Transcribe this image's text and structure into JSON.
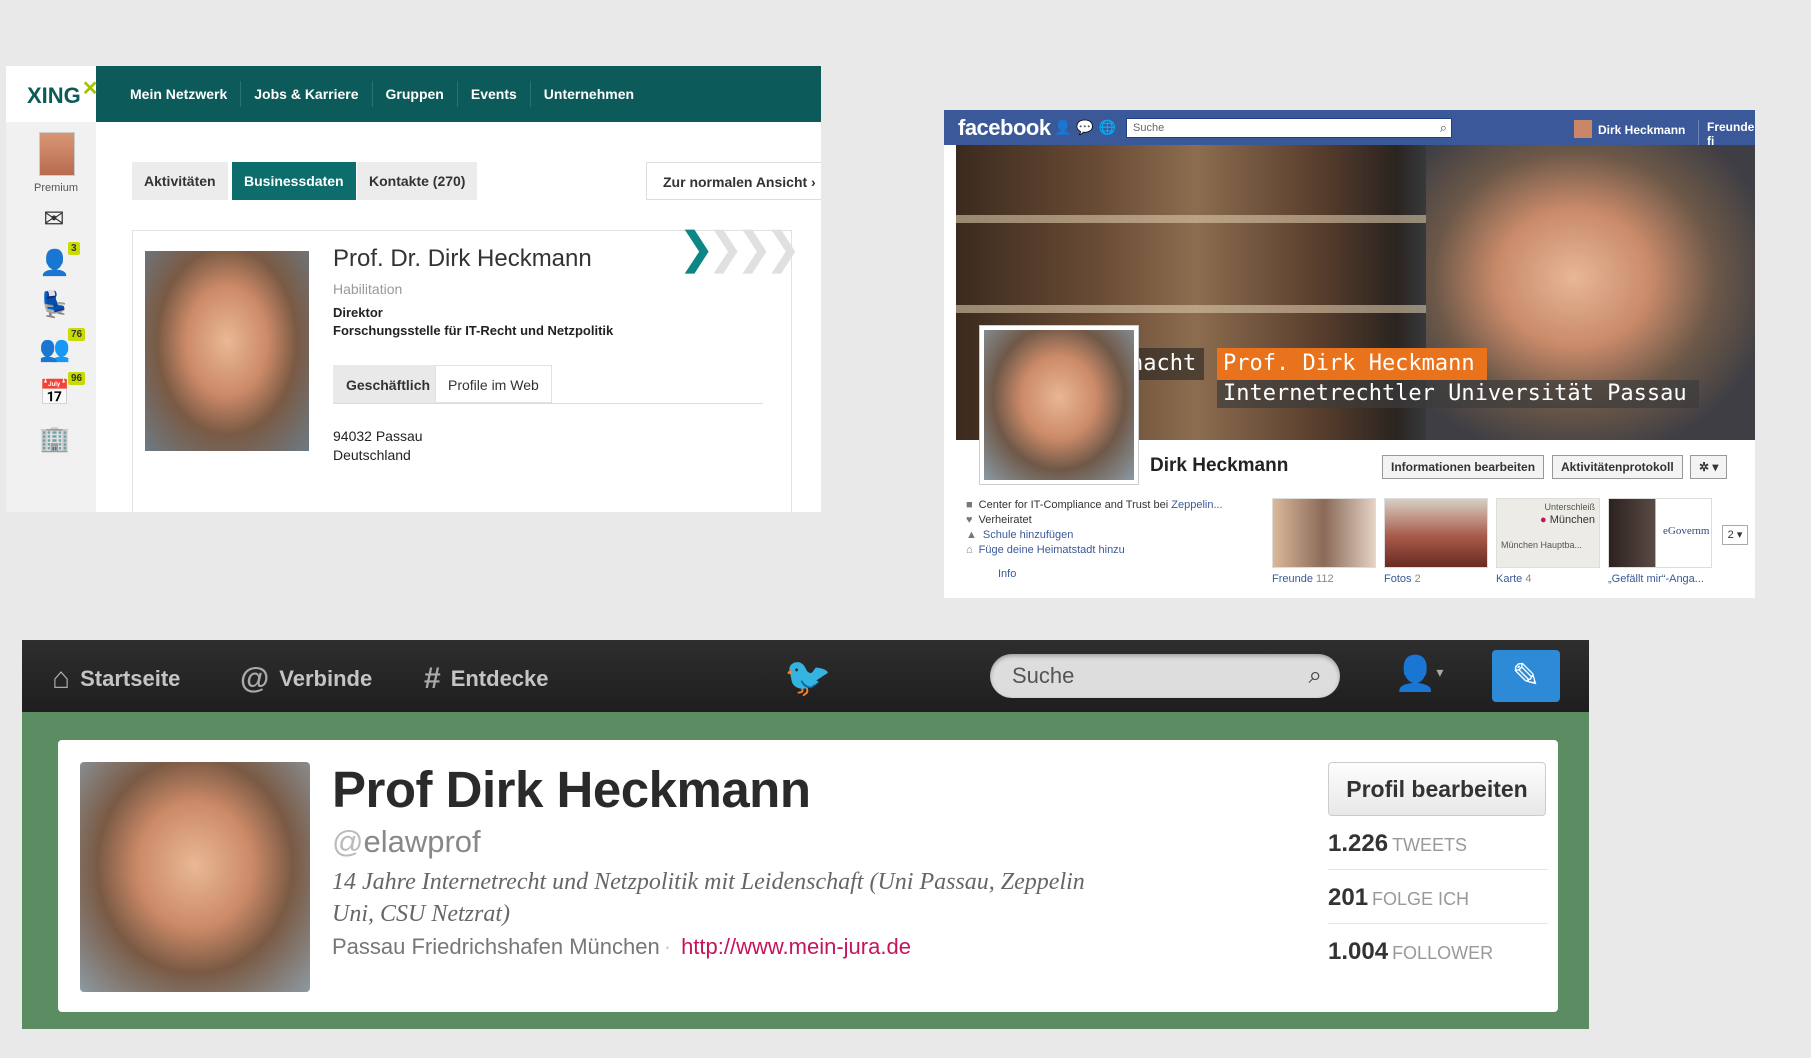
{
  "xing": {
    "logo": "XING",
    "nav": [
      "Mein Netzwerk",
      "Jobs & Karriere",
      "Gruppen",
      "Events",
      "Unternehmen"
    ],
    "side": {
      "premium": "Premium",
      "badges": [
        "3",
        "76",
        "96"
      ]
    },
    "tabs": [
      "Aktivitäten",
      "Businessdaten",
      "Kontakte (270)"
    ],
    "normal_view": "Zur normalen Ansicht ›",
    "name": "Prof. Dr. Dirk Heckmann",
    "subtitle": "Habilitation",
    "role": "Direktor",
    "org": "Forschungsstelle für IT-Recht und Netzpolitik",
    "inner_tabs": [
      "Geschäftlich",
      "Profile im Web"
    ],
    "address": [
      "94032 Passau",
      "Deutschland"
    ]
  },
  "facebook": {
    "logo": "facebook",
    "search_placeholder": "Suche",
    "user": "Dirk Heckmann",
    "friends_link": "Freunde fi",
    "cover_text": [
      "nacht",
      "Prof. Dirk Heckmann",
      "Internetrechtler Universität Passau"
    ],
    "profile_name": "Dirk Heckmann",
    "buttons": [
      "Informationen bearbeiten",
      "Aktivitätenprotokoll",
      "✲ ▾"
    ],
    "info": [
      {
        "text": "Center for IT-Compliance and Trust bei ",
        "link": "Zeppelin..."
      },
      {
        "text": "Verheiratet",
        "link": ""
      },
      {
        "text": "",
        "link": "Schule hinzufügen"
      },
      {
        "text": "",
        "link": "Füge deine Heimatstadt hinzu"
      }
    ],
    "info_label": "Info",
    "thumbs": [
      {
        "label": "Freunde",
        "count": "112"
      },
      {
        "label": "Fotos",
        "count": "2"
      },
      {
        "label": "Karte",
        "count": "4"
      },
      {
        "label": "„Gefällt mir“-Anga...",
        "count": ""
      }
    ],
    "map_labels": [
      "Unterschleiß",
      "München",
      "München Hauptba..."
    ],
    "likes_text": "eGovernm",
    "more": "2 ▾"
  },
  "twitter": {
    "nav": [
      {
        "icon": "home-icon",
        "label": "Startseite"
      },
      {
        "icon": "at-icon",
        "label": "Verbinde"
      },
      {
        "icon": "hash-icon",
        "label": "Entdecke"
      }
    ],
    "search_placeholder": "Suche",
    "name": "Prof Dirk Heckmann",
    "handle": "elawprof",
    "bio": "14 Jahre Internetrecht und Netzpolitik mit Leidenschaft (Uni Passau, Zeppelin Uni, CSU Netzrat)",
    "location": "Passau Friedrichshafen München",
    "url": "http://www.mein-jura.de",
    "edit_button": "Profil bearbeiten",
    "stats": [
      {
        "value": "1.226",
        "label": "TWEETS"
      },
      {
        "value": "201",
        "label": "FOLGE ICH"
      },
      {
        "value": "1.004",
        "label": "FOLLOWER"
      }
    ]
  }
}
